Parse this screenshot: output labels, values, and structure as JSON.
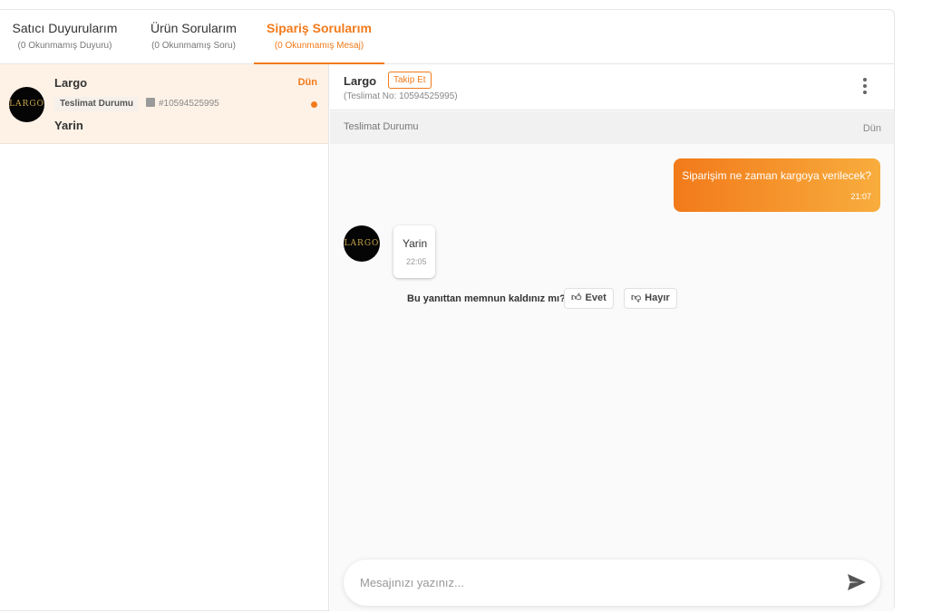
{
  "tabs": [
    {
      "title": "Satıcı Duyurularım",
      "subtitle": "(0 Okunmamış Duyuru)"
    },
    {
      "title": "Ürün Sorularım",
      "subtitle": "(0 Okunmamış Soru)"
    },
    {
      "title": "Sipariş Sorularım",
      "subtitle": "(0 Okunmamış Mesaj)"
    }
  ],
  "active_tab": 2,
  "conversation": {
    "seller": "Largo",
    "avatar_text": "LARGO",
    "date": "Dün",
    "topic": "Teslimat Durumu",
    "order_no": "#10594525995",
    "last_message": "Yarin"
  },
  "chat": {
    "seller": "Largo",
    "follow_label": "Takip Et",
    "order_info": "(Teslimat No: 10594525995)",
    "topic": "Teslimat Durumu",
    "topic_date": "Dün",
    "messages": [
      {
        "direction": "out",
        "text": "Siparişim ne zaman kargoya verilecek?",
        "time": "21:07"
      },
      {
        "direction": "in",
        "text": "Yarin",
        "time": "22:05"
      }
    ],
    "feedback": {
      "question": "Bu yanıttan memnun kaldınız mı?",
      "yes_label": "Evet",
      "no_label": "Hayır"
    },
    "composer_placeholder": "Mesajınızı yazınız..."
  },
  "colors": {
    "accent": "#f27a1a",
    "accent_light": "#f8ad3d",
    "selected_bg": "#fef2e7"
  },
  "icons": [
    "package-icon",
    "thumbs-up-icon",
    "thumbs-down-icon",
    "kebab-menu-icon",
    "send-icon"
  ]
}
